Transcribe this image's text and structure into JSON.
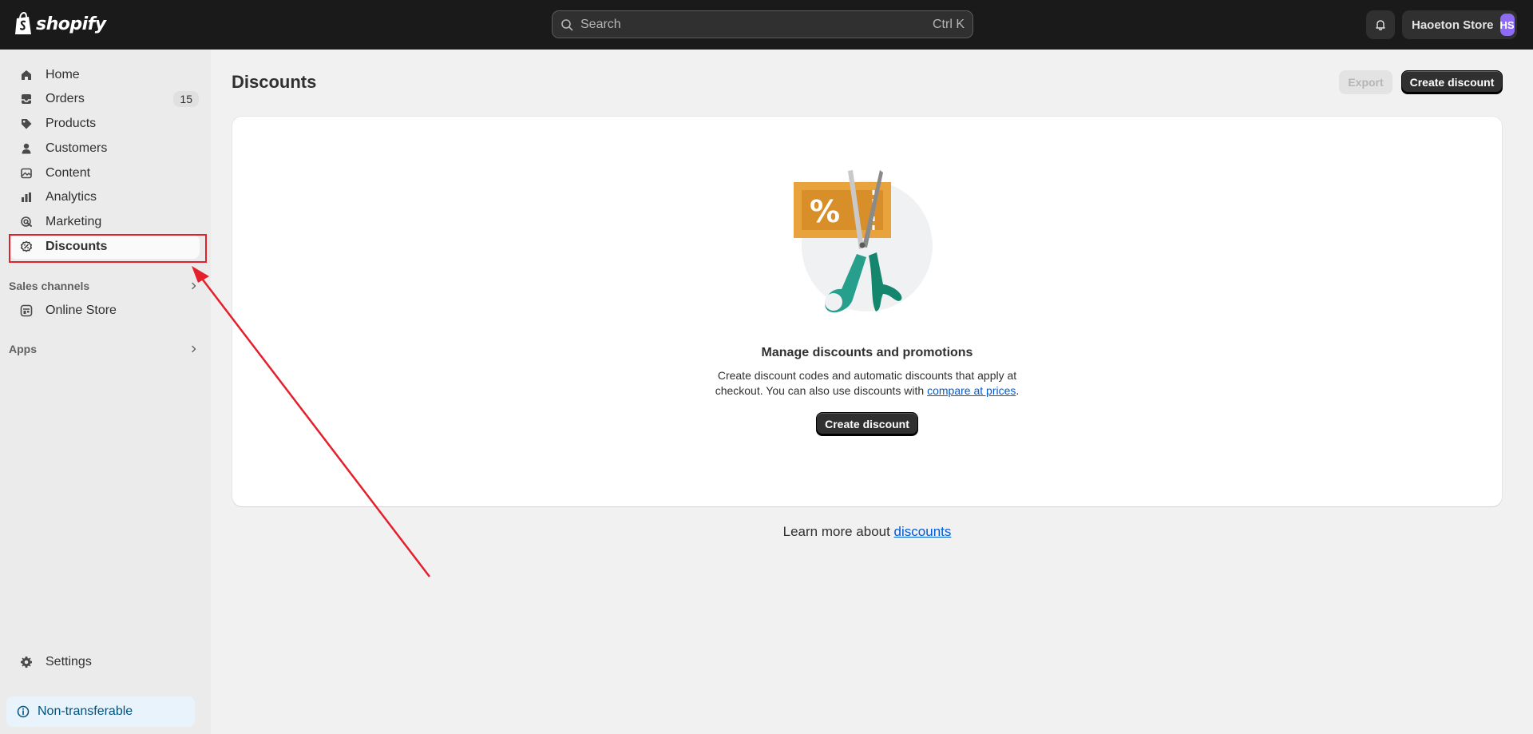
{
  "topbar": {
    "brand": "shopify",
    "search": {
      "placeholder": "Search",
      "shortcut": "Ctrl K"
    },
    "store": {
      "name": "Haoeton Store",
      "initials": "HS"
    }
  },
  "sidebar": {
    "items": [
      {
        "label": "Home",
        "icon": "home-icon"
      },
      {
        "label": "Orders",
        "icon": "inbox-icon",
        "badge": "15"
      },
      {
        "label": "Products",
        "icon": "tag-icon"
      },
      {
        "label": "Customers",
        "icon": "person-icon"
      },
      {
        "label": "Content",
        "icon": "content-icon"
      },
      {
        "label": "Analytics",
        "icon": "bar-chart-icon"
      },
      {
        "label": "Marketing",
        "icon": "target-icon"
      },
      {
        "label": "Discounts",
        "icon": "discount-icon",
        "active": true
      }
    ],
    "sales_channels": {
      "heading": "Sales channels",
      "items": [
        {
          "label": "Online Store",
          "icon": "store-icon"
        }
      ]
    },
    "apps": {
      "heading": "Apps"
    },
    "settings": {
      "label": "Settings",
      "icon": "gear-icon"
    },
    "notice": {
      "label": "Non-transferable",
      "icon": "info-icon"
    }
  },
  "main": {
    "title": "Discounts",
    "export_label": "Export",
    "create_label": "Create discount",
    "empty_state": {
      "title": "Manage discounts and promotions",
      "desc_prefix": "Create discount codes and automatic discounts that apply at checkout. You can also use discounts with ",
      "desc_link": "compare at prices",
      "desc_suffix": ".",
      "button_label": "Create discount"
    },
    "learn_more_prefix": "Learn more about ",
    "learn_more_link": "discounts"
  },
  "colors": {
    "topbar": "#1a1a1a",
    "sidebar": "#ebebeb",
    "background": "#f1f1f1",
    "primary_button": "#303030",
    "link": "#005bd3",
    "avatar": "#8e6bf5",
    "annotation": "#e3202c"
  }
}
